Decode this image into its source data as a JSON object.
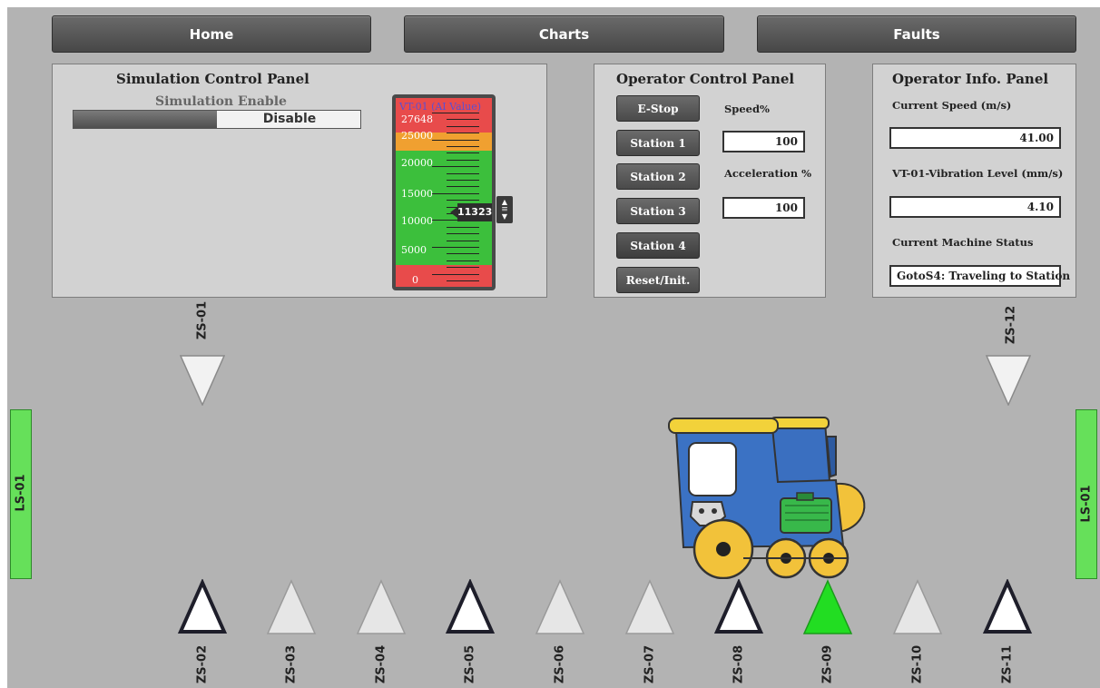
{
  "nav": {
    "home": "Home",
    "charts": "Charts",
    "faults": "Faults"
  },
  "simulation_panel": {
    "title": "Simulation Control Panel",
    "enable_label": "Simulation Enable",
    "toggle_state": "Disable",
    "gauge": {
      "title": "VT-01 (AI Value)",
      "scale_labels": [
        "27648",
        "25000",
        "20000",
        "15000",
        "10000",
        "5000",
        "0"
      ],
      "value": "11323"
    }
  },
  "operator_control": {
    "title": "Operator Control Panel",
    "buttons": {
      "estop": "E-Stop",
      "station1": "Station 1",
      "station2": "Station 2",
      "station3": "Station 3",
      "station4": "Station 4",
      "reset": "Reset/Init."
    },
    "speed_label": "Speed%",
    "speed_value": "100",
    "accel_label": "Acceleration %",
    "accel_value": "100"
  },
  "operator_info": {
    "title": "Operator Info. Panel",
    "speed_label": "Current Speed (m/s)",
    "speed_value": "41.00",
    "vibration_label": "VT-01-Vibration Level (mm/s)",
    "vibration_value": "4.10",
    "status_label": "Current Machine Status",
    "status_value": "GotoS4: Traveling to Station"
  },
  "sensors": {
    "zs01": "ZS-01",
    "zs12": "ZS-12",
    "ls_left": "LS-01",
    "ls_right": "LS-01",
    "bottom": [
      "ZS-02",
      "ZS-03",
      "ZS-04",
      "ZS-05",
      "ZS-06",
      "ZS-07",
      "ZS-08",
      "ZS-09",
      "ZS-10",
      "ZS-11"
    ],
    "bottom_states": [
      "active",
      "inactive",
      "inactive",
      "active",
      "inactive",
      "inactive",
      "active",
      "triggered",
      "inactive",
      "active"
    ]
  },
  "colors": {
    "background": "#b3b3b3",
    "panel": "#d2d2d2",
    "limit_switch": "#66e05a",
    "triggered": "#22dd22",
    "alarm_red": "#e84b4b",
    "warn_orange": "#f0a030",
    "ok_green": "#3cbf3c"
  }
}
